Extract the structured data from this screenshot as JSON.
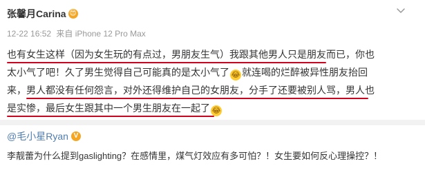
{
  "author": {
    "name": "张馨月Carina",
    "badge_emoji": "😍"
  },
  "meta": {
    "time": "12-22 16:52",
    "source": "来自 iPhone 12 Pro Max"
  },
  "post": {
    "lines": [
      "也有女生这样（因为女生玩的有点过，男朋友生气）我跟其他男人只是朋友而已，你也",
      "太小气了吧！久了男生觉得自己可能真的是太小气了",
      "就连喝的烂醉被异性朋友抬回",
      "来，男人都没有任何怨言，对外还得维护自己的女朋友，分手了还要被别人骂，男人也",
      "是实惨，最后女生跟其中一个男生朋友在一起了"
    ],
    "emoji_1": "😂",
    "emoji_2": "😂"
  },
  "repost": {
    "user": "@毛小星Ryan",
    "verified": "V",
    "text": "李靓蕾为什么提到gaslighting？在感情里，煤气灯效应有多可怕？！女生要如何反心理操控？！"
  },
  "icons": {
    "more": "chevron-down-icon"
  },
  "colors": {
    "underline": "#d0021b",
    "link": "#507daf",
    "muted": "#999999"
  }
}
